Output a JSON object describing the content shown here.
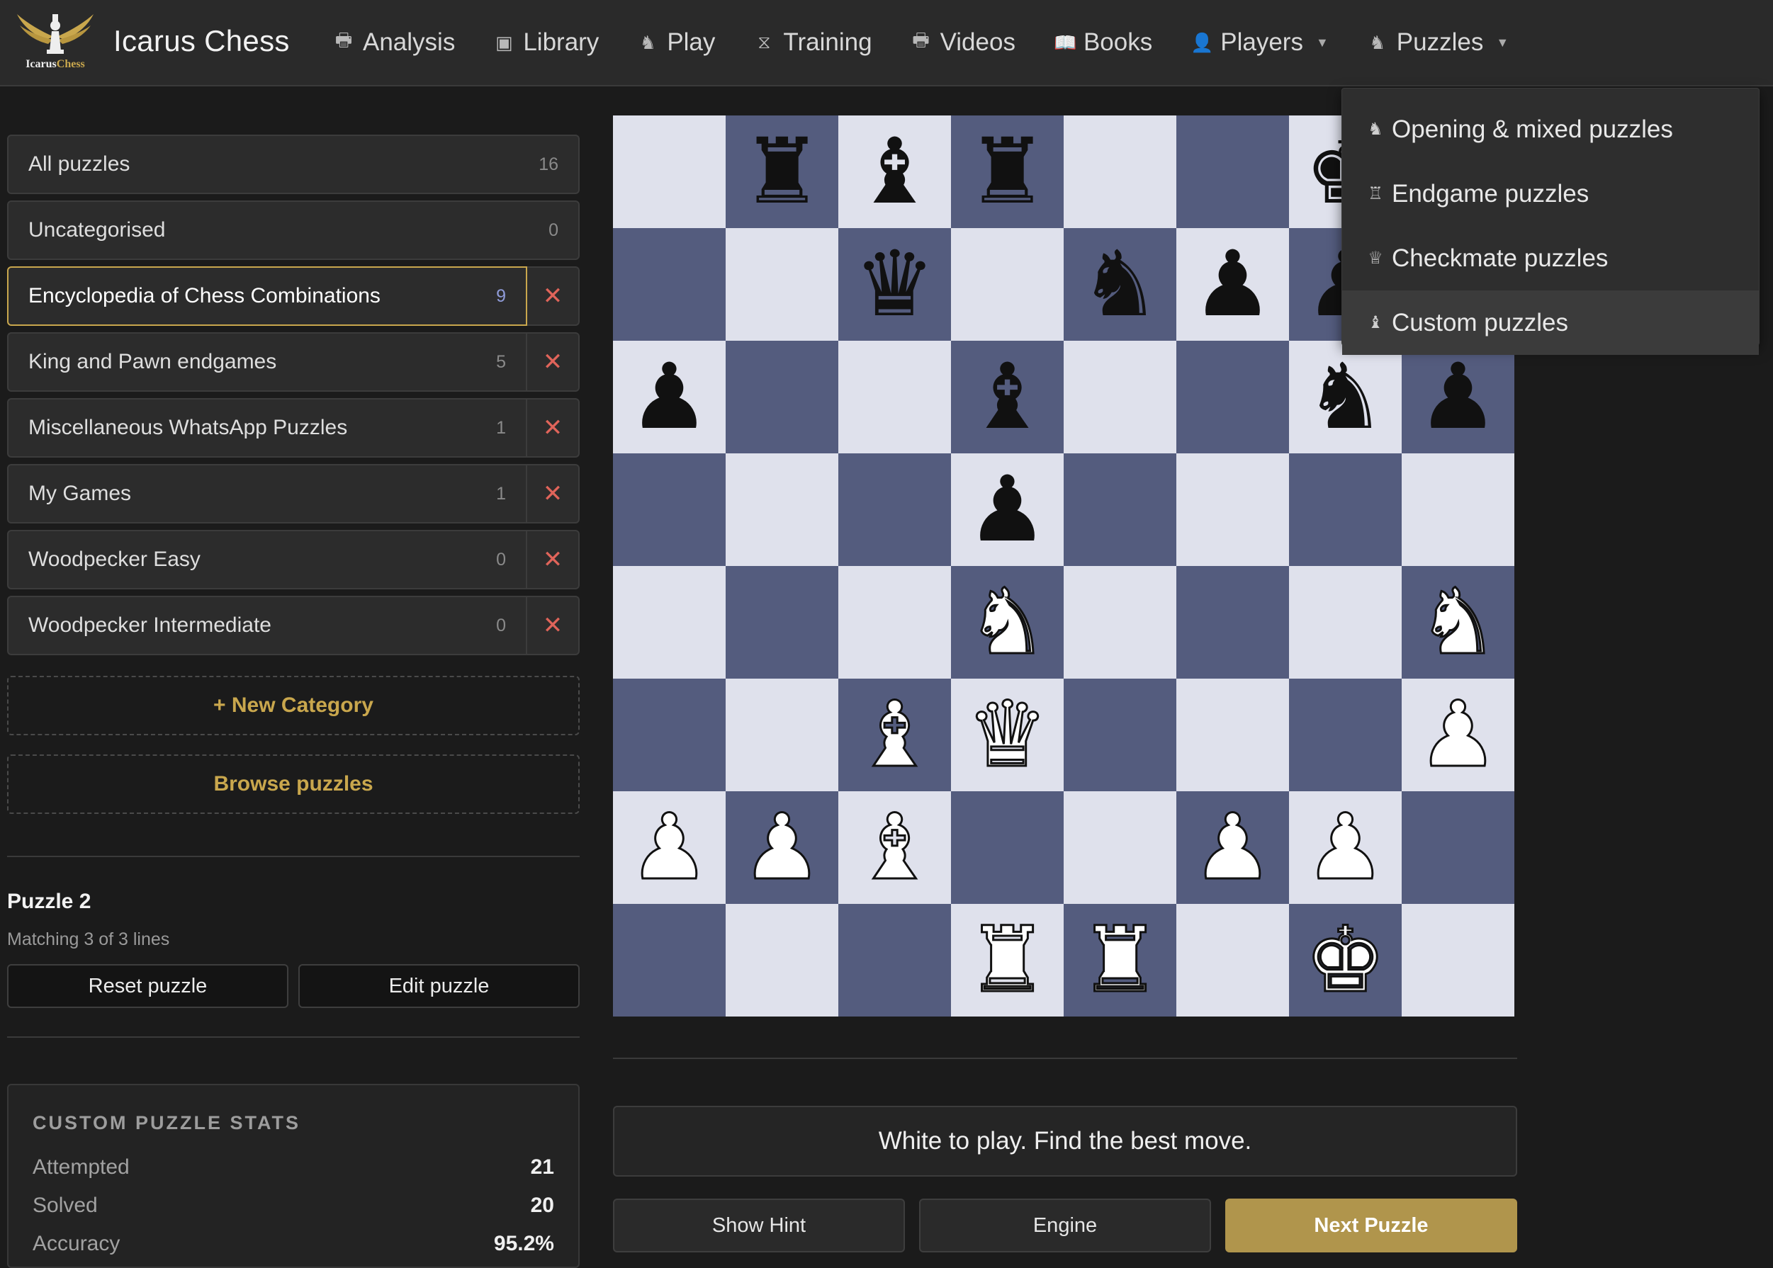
{
  "brand": {
    "logo_text_a": "Icarus",
    "logo_text_b": "Chess",
    "name": "Icarus Chess"
  },
  "nav": {
    "items": [
      {
        "label": "Analysis",
        "icon": "monitor-icon"
      },
      {
        "label": "Library",
        "icon": "chessboard-icon"
      },
      {
        "label": "Play",
        "icon": "knight-icon"
      },
      {
        "label": "Training",
        "icon": "hourglass-icon"
      },
      {
        "label": "Videos",
        "icon": "monitor-icon"
      },
      {
        "label": "Books",
        "icon": "book-icon"
      },
      {
        "label": "Players",
        "icon": "user-icon"
      },
      {
        "label": "Puzzles",
        "icon": "knight-icon"
      }
    ]
  },
  "puzzles_menu": {
    "items": [
      {
        "label": "Opening & mixed puzzles",
        "icon": "knight-icon"
      },
      {
        "label": "Endgame puzzles",
        "icon": "rook-icon"
      },
      {
        "label": "Checkmate puzzles",
        "icon": "queen-icon"
      },
      {
        "label": "Custom puzzles",
        "icon": "bishop-icon"
      }
    ],
    "active": "Custom puzzles"
  },
  "categories": [
    {
      "name": "All puzzles",
      "count": "16"
    },
    {
      "name": "Uncategorised",
      "count": "0"
    },
    {
      "name": "Encyclopedia of Chess Combinations",
      "count": "9",
      "selected": true
    },
    {
      "name": "King and Pawn endgames",
      "count": "5"
    },
    {
      "name": "Miscellaneous WhatsApp Puzzles",
      "count": "1"
    },
    {
      "name": "My Games",
      "count": "1"
    },
    {
      "name": "Woodpecker Easy",
      "count": "0"
    },
    {
      "name": "Woodpecker Intermediate",
      "count": "0"
    }
  ],
  "actions": {
    "new_category": "+ New Category",
    "browse": "Browse puzzles"
  },
  "puzzle": {
    "title": "Puzzle 2",
    "matching": "Matching 3 of 3 lines",
    "reset": "Reset puzzle",
    "edit": "Edit puzzle"
  },
  "stats": {
    "title": "CUSTOM PUZZLE STATS",
    "rows": [
      {
        "label": "Attempted",
        "value": "21"
      },
      {
        "label": "Solved",
        "value": "20"
      },
      {
        "label": "Accuracy",
        "value": "95.2%"
      }
    ]
  },
  "board": {
    "light_color": "#dfe1ec",
    "dark_color": "#545c7e",
    "rows": [
      [
        "",
        "r",
        "b",
        "r",
        "",
        "",
        "k",
        ""
      ],
      [
        "",
        "",
        "q",
        "",
        "n",
        "p",
        "p",
        ""
      ],
      [
        "p",
        "",
        "",
        "b",
        "",
        "",
        "n",
        "p"
      ],
      [
        "",
        "",
        "",
        "p",
        "",
        "",
        "",
        ""
      ],
      [
        "",
        "",
        "",
        "N",
        "",
        "",
        "",
        "N"
      ],
      [
        "",
        "",
        "B",
        "Q",
        "",
        "",
        "",
        "P"
      ],
      [
        "P",
        "P",
        "B",
        "",
        "",
        "P",
        "P",
        ""
      ],
      [
        "",
        "",
        "",
        "R",
        "R",
        "",
        "K",
        ""
      ]
    ]
  },
  "prompt": "White to play. Find the best move.",
  "controls": {
    "hint": "Show Hint",
    "engine": "Engine",
    "next": "Next Puzzle"
  },
  "colors": {
    "accent": "#c9a74d",
    "danger": "#e0645a"
  }
}
